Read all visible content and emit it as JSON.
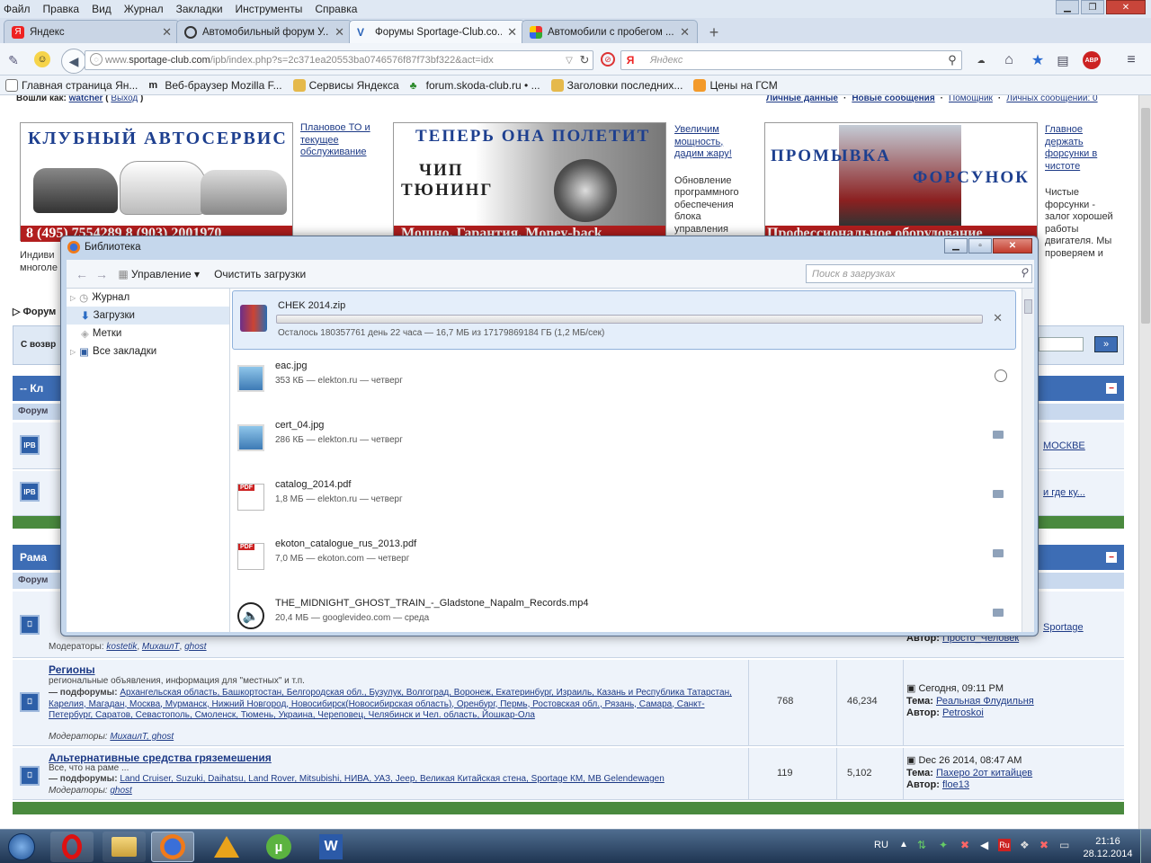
{
  "menu": [
    "Файл",
    "Правка",
    "Вид",
    "Журнал",
    "Закладки",
    "Инструменты",
    "Справка"
  ],
  "tabs": [
    {
      "title": "Яндекс",
      "icon": "yandex-icon",
      "active": false
    },
    {
      "title": "Автомобильный форум У...",
      "icon": "steering-wheel-icon",
      "active": false
    },
    {
      "title": "Форумы Sportage-Club.co...",
      "icon": "sportage-icon",
      "active": true
    },
    {
      "title": "Автомобили с пробегом ...",
      "icon": "colorful-icon",
      "active": false
    }
  ],
  "nav": {
    "url_prefix": "www.",
    "url_domain": "sportage-club.com",
    "url_rest": "/ipb/index.php?s=2c371ea20553ba0746576f87f73bf322&act=idx",
    "search_placeholder": "Яндекс"
  },
  "bookmarks": [
    "Главная страница Ян...",
    "Веб-браузер Mozilla F...",
    "Сервисы Яндекса",
    "forum.skoda-club.ru • ...",
    "Заголовки последних...",
    "Цены на ГСМ"
  ],
  "page": {
    "top_user_label": "Вошли как:",
    "top_user_name": "watcher",
    "top_logout": "Выход",
    "top_links": [
      "Личные данные",
      "Новые сообщения",
      "Помощник",
      "Личных сообщений: 0"
    ],
    "ad1_title": "КЛУБНЫЙ АВТОСЕРВИС",
    "ad1_phone": "8 (495) 7554289 8 (903) 2001970",
    "ad1_links": [
      "Плановое ТО и",
      "текущее",
      "обслуживание"
    ],
    "ad2_title": "ТЕПЕРЬ ОНА ПОЛЕТИТ",
    "ad2_chip": "ЧИП",
    "ad2_tuning": "ТЮНИНГ",
    "ad2_bar": "Мощно. Гарантия. Money-back",
    "ad2_links": [
      "Увеличим",
      "мощность,",
      "дадим жару!"
    ],
    "ad2_text": [
      "Обновление",
      "программного",
      "обеспечения",
      "блока",
      "управления"
    ],
    "ad3_title1": "ПРОМЫВКА",
    "ad3_title2": "ФОРСУНОК",
    "ad3_bar": "Профессиональное оборудование",
    "ad3_links": [
      "Главное",
      "держать",
      "форсунки в",
      "чистоте"
    ],
    "ad3_text": [
      "Чистые",
      "форсунки -",
      "залог хорошей",
      "работы",
      "двигателя. Мы",
      "проверяем и"
    ],
    "left_text1": "Индиви",
    "left_text2": "многоле",
    "forum_nav": "Форум",
    "welcome": "С возвр",
    "cat1": "-- Кл",
    "cat1_sub": "Форум",
    "cat2": "Рама",
    "cat2_sub": "Форум",
    "row1_right": "МОСКВЕ",
    "row2_right": "и где ку...",
    "row3_right_link": "Sportage",
    "row3_author_label": "Автор:",
    "row3_author": "Просто_Человек",
    "row3_moderators_label": "Модераторы:",
    "row3_moderators": [
      "kostetik",
      "МихаилТ",
      "ghost"
    ],
    "region_title": "Регионы",
    "region_desc": "региональные объявления, информация для \"местных\" и т.п.",
    "region_sub_label": "— подфорумы:",
    "region_sub": "Архангельская область, Башкортостан, Белгородская обл., Бузулук, Волгоград, Воронеж, Екатеринбург, Израиль, Казань и Республика Татарстан, Карелия, Магадан, Москва, Мурманск, Нижний Новгород, Новосибирск(Новосибирская область), Оренбург, Пермь, Ростовская обл., Рязань, Самара, Санкт-Петербург, Саратов, Севастополь, Смоленск, Тюмень, Украина, Череповец, Челябинск и Чел. область, Йошкар-Ола",
    "region_mods_label": "Модераторы:",
    "region_mods": "МихаилТ, ghost",
    "region_topics": "768",
    "region_posts": "46,234",
    "region_date": "Сегодня, 09:11 PM",
    "region_theme_label": "Тема:",
    "region_theme": "Реальная Флудильня",
    "region_author_label": "Автор:",
    "region_author": "Petroskoi",
    "alt_title": "Альтернативные средства гряземешения",
    "alt_desc": "Все, что на раме ...",
    "alt_sub_label": "— подфорумы:",
    "alt_sub": "Land Cruiser, Suzuki, Daihatsu, Land Rover, Mitsubishi, НИВА, УАЗ, Jeep, Великая Китайская стена, Sportage КМ, МВ Gelendewagen",
    "alt_mods_label": "Модераторы:",
    "alt_mods": "ghost",
    "alt_topics": "119",
    "alt_posts": "5,102",
    "alt_date": "Dec 26 2014, 08:47 AM",
    "alt_theme_label": "Тема:",
    "alt_theme": "Пахеро 2от китайцев",
    "alt_author_label": "Автор:",
    "alt_author": "floe13"
  },
  "dialog": {
    "title": "Библиотека",
    "manage": "Управление",
    "clear": "Очистить загрузки",
    "search_placeholder": "Поиск в загрузках",
    "tree": [
      {
        "label": "Журнал",
        "icon": "clock-icon"
      },
      {
        "label": "Загрузки",
        "icon": "download-arrow-icon"
      },
      {
        "label": "Метки",
        "icon": "tag-icon"
      },
      {
        "label": "Все закладки",
        "icon": "bookmarks-icon"
      }
    ],
    "active": {
      "name": "CHEK 2014.zip",
      "status": "Осталось 180357761 день 22 часа — 16,7 МБ из 17179869184 ГБ (1,2 МБ/сек)",
      "progress": 0.0
    },
    "items": [
      {
        "name": "eac.jpg",
        "meta": "353 КБ — elekton.ru — четверг",
        "icon": "image-file-icon"
      },
      {
        "name": "cert_04.jpg",
        "meta": "286 КБ — elekton.ru — четверг",
        "icon": "image-file-icon"
      },
      {
        "name": "catalog_2014.pdf",
        "meta": "1,8 МБ — elekton.ru — четверг",
        "icon": "pdf-file-icon"
      },
      {
        "name": "ekoton_catalogue_rus_2013.pdf",
        "meta": "7,0 МБ — ekoton.com — четверг",
        "icon": "pdf-file-icon"
      },
      {
        "name": "THE_MIDNIGHT_GHOST_TRAIN_-_Gladstone_Napalm_Records.mp4",
        "meta": "20,4 МБ — googlevideo.com — среда",
        "icon": "audio-file-icon"
      }
    ]
  },
  "taskbar": {
    "lang": "RU",
    "time": "21:16",
    "date": "28.12.2014"
  }
}
